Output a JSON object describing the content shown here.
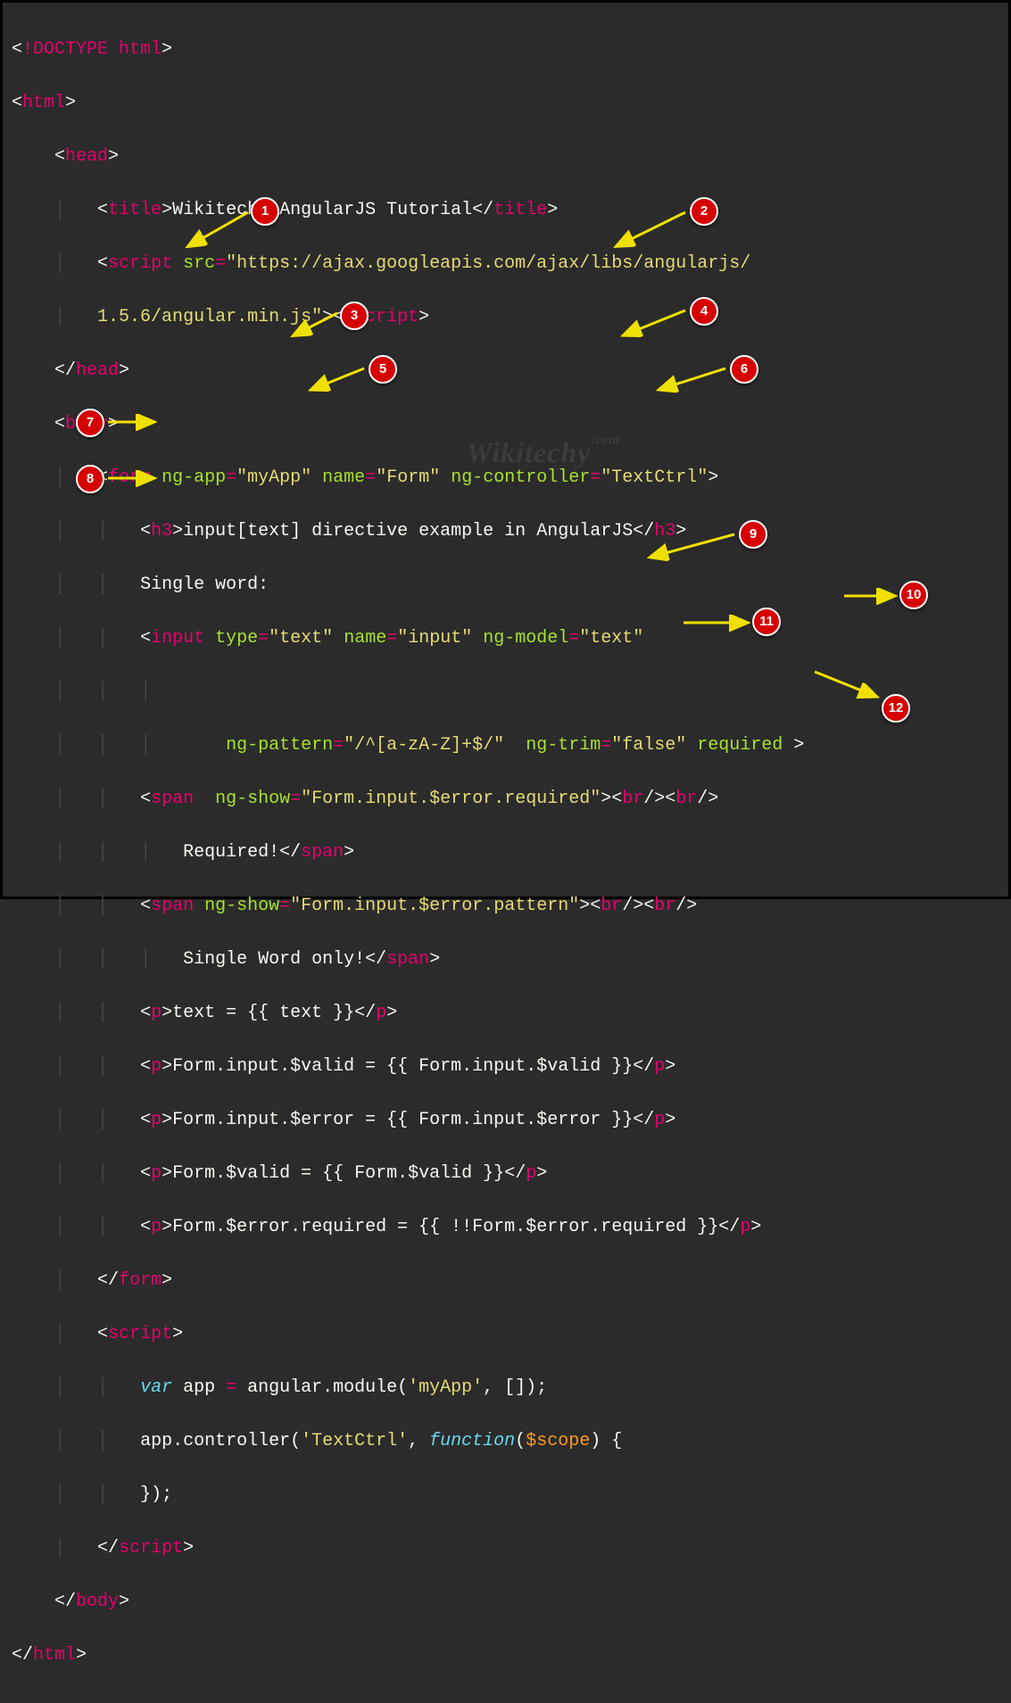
{
  "code": {
    "doctype": "!DOCTYPE html",
    "html_open": "html",
    "head_open": "head",
    "title_open": "title",
    "title_text": "Wikitechy AngularJS Tutorial",
    "title_close": "title",
    "script_open": "script",
    "src_attr": "src",
    "src_val": "\"https://ajax.googleapis.com/ajax/libs/angularjs/",
    "src_val2": "1.5.6/angular.min.js\"",
    "script_close": "script",
    "head_close": "head",
    "body_open": "body",
    "form_open": "form",
    "ngapp_attr": "ng-app",
    "ngapp_val": "\"myApp\"",
    "name_attr": "name",
    "name_val": "\"Form\"",
    "ngcontroller_attr": "ng-controller",
    "ngcontroller_val": "\"TextCtrl\"",
    "h3_open": "h3",
    "h3_text": "input[text] directive example in AngularJS",
    "h3_close": "h3",
    "single_word_label": "Single word:",
    "input_open": "input",
    "type_attr": "type",
    "type_val": "\"text\"",
    "name2_attr": "name",
    "name2_val": "\"input\"",
    "ngmodel_attr": "ng-model",
    "ngmodel_val": "\"text\"",
    "ngpattern_attr": "ng-pattern",
    "ngpattern_val": "\"/^[a-zA-Z]+$/\"",
    "ngtrim_attr": "ng-trim",
    "ngtrim_val": "\"false\"",
    "required_attr": "required",
    "span_open": "span",
    "ngshow_attr": "ng-show",
    "ngshow_val1": "\"Form.input.$error.required\"",
    "br": "br",
    "required_text": "Required!",
    "span_close": "span",
    "ngshow_val2": "\"Form.input.$error.pattern\"",
    "singleword_text": "Single Word only!",
    "p_open": "p",
    "p_close": "p",
    "p1_text": "text = {{ text }}",
    "p2_text": "Form.input.$valid = {{ Form.input.$valid }}",
    "p3_text": "Form.input.$error = {{ Form.input.$error }}",
    "p4_text": "Form.$valid = {{ Form.$valid }}",
    "p5_text": "Form.$error.required = {{ !!Form.$error.required }}",
    "form_close": "form",
    "var_kw": "var",
    "app_var": " app ",
    "eq": "=",
    "module_text": " angular.module(",
    "myapp_str": "'myApp'",
    "comma_arr": ", []);",
    "controller_text": "app.controller(",
    "textctrl_str": "'TextCtrl'",
    "comma": ", ",
    "function_kw": "function",
    "scope_param": "$scope",
    "func_body": ") {",
    "func_close": "});",
    "body_close": "body",
    "html_close": "html"
  },
  "badges": {
    "b1": "1",
    "b2": "2",
    "b3": "3",
    "b4": "4",
    "b5": "5",
    "b6": "6",
    "b7": "7",
    "b8": "8",
    "b9": "9",
    "b10": "10",
    "b11": "11",
    "b12": "12"
  },
  "watermark": "Wikitechy"
}
